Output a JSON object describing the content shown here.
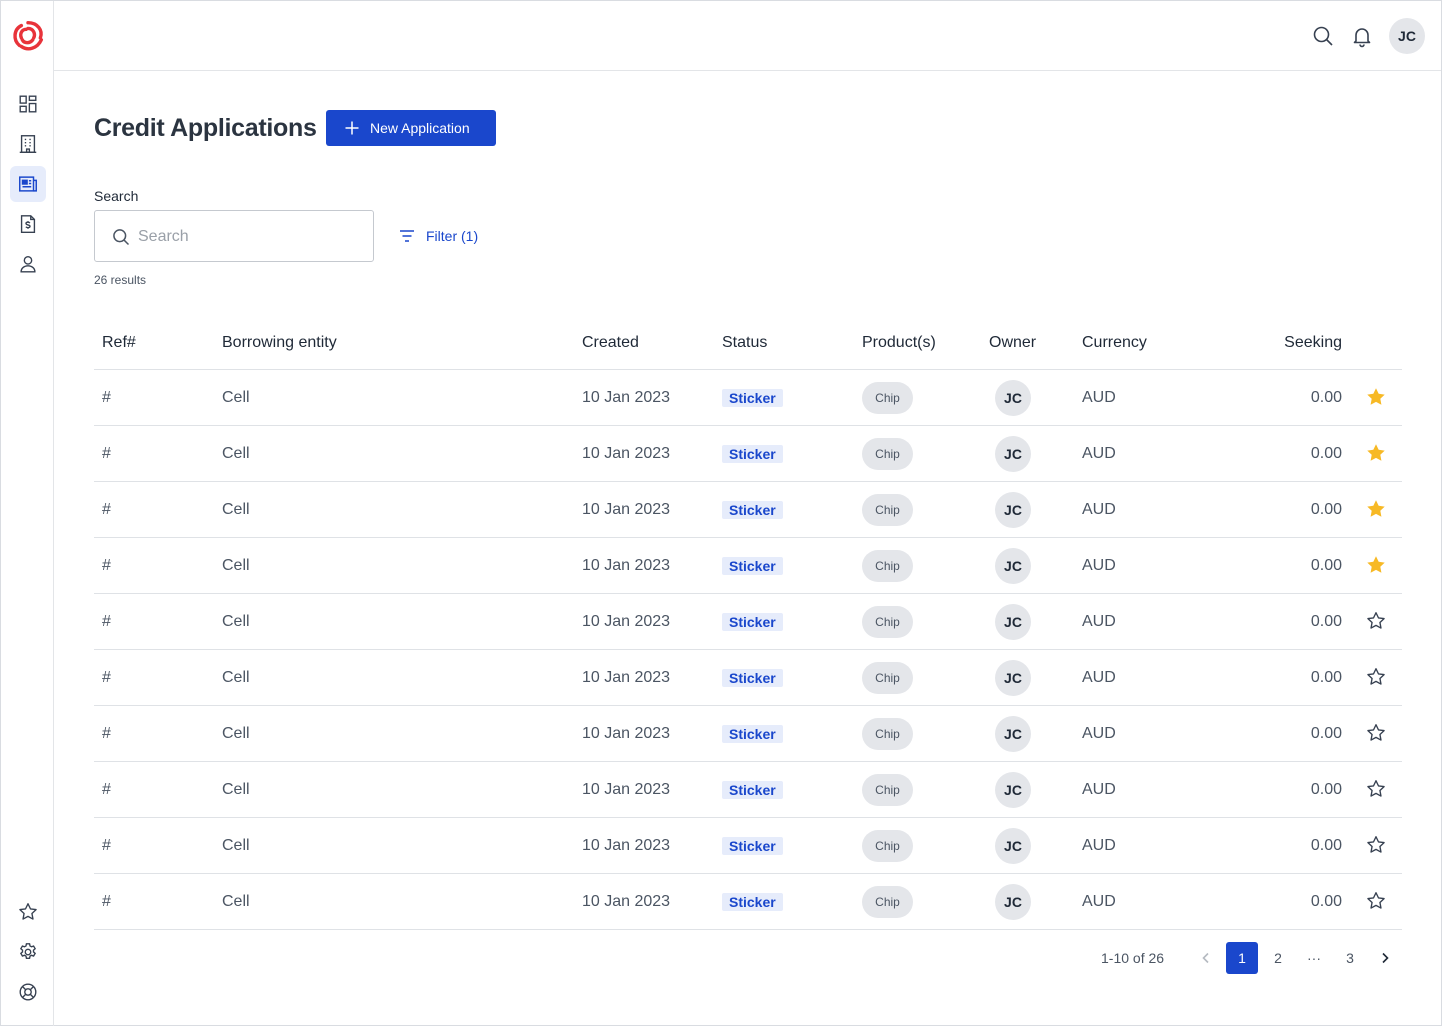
{
  "header": {
    "user_initials": "JC"
  },
  "page": {
    "title": "Credit Applications",
    "new_button_label": "New Application",
    "search_label": "Search",
    "search_placeholder": "Search",
    "search_value": "",
    "filter_label": "Filter (1)",
    "results_text": "26 results"
  },
  "table": {
    "columns": [
      "Ref#",
      "Borrowing entity",
      "Created",
      "Status",
      "Product(s)",
      "Owner",
      "Currency",
      "Seeking"
    ],
    "rows": [
      {
        "ref": "#",
        "entity": "Cell",
        "created": "10 Jan 2023",
        "status": "Sticker",
        "product": "Chip",
        "owner": "JC",
        "currency": "AUD",
        "seeking": "0.00",
        "starred": true
      },
      {
        "ref": "#",
        "entity": "Cell",
        "created": "10 Jan 2023",
        "status": "Sticker",
        "product": "Chip",
        "owner": "JC",
        "currency": "AUD",
        "seeking": "0.00",
        "starred": true
      },
      {
        "ref": "#",
        "entity": "Cell",
        "created": "10 Jan 2023",
        "status": "Sticker",
        "product": "Chip",
        "owner": "JC",
        "currency": "AUD",
        "seeking": "0.00",
        "starred": true
      },
      {
        "ref": "#",
        "entity": "Cell",
        "created": "10 Jan 2023",
        "status": "Sticker",
        "product": "Chip",
        "owner": "JC",
        "currency": "AUD",
        "seeking": "0.00",
        "starred": true
      },
      {
        "ref": "#",
        "entity": "Cell",
        "created": "10 Jan 2023",
        "status": "Sticker",
        "product": "Chip",
        "owner": "JC",
        "currency": "AUD",
        "seeking": "0.00",
        "starred": false
      },
      {
        "ref": "#",
        "entity": "Cell",
        "created": "10 Jan 2023",
        "status": "Sticker",
        "product": "Chip",
        "owner": "JC",
        "currency": "AUD",
        "seeking": "0.00",
        "starred": false
      },
      {
        "ref": "#",
        "entity": "Cell",
        "created": "10 Jan 2023",
        "status": "Sticker",
        "product": "Chip",
        "owner": "JC",
        "currency": "AUD",
        "seeking": "0.00",
        "starred": false
      },
      {
        "ref": "#",
        "entity": "Cell",
        "created": "10 Jan 2023",
        "status": "Sticker",
        "product": "Chip",
        "owner": "JC",
        "currency": "AUD",
        "seeking": "0.00",
        "starred": false
      },
      {
        "ref": "#",
        "entity": "Cell",
        "created": "10 Jan 2023",
        "status": "Sticker",
        "product": "Chip",
        "owner": "JC",
        "currency": "AUD",
        "seeking": "0.00",
        "starred": false
      },
      {
        "ref": "#",
        "entity": "Cell",
        "created": "10 Jan 2023",
        "status": "Sticker",
        "product": "Chip",
        "owner": "JC",
        "currency": "AUD",
        "seeking": "0.00",
        "starred": false
      }
    ]
  },
  "pagination": {
    "range_text": "1-10 of 26",
    "pages": [
      "1",
      "2",
      "···",
      "3"
    ],
    "current": "1"
  },
  "colors": {
    "accent": "#1a47cc",
    "star_filled": "#f7b925",
    "logo": "#e8333a"
  },
  "icons": {
    "sidebar_top": [
      "dashboard-icon",
      "building-icon",
      "applications-icon",
      "invoice-icon",
      "user-icon"
    ],
    "sidebar_bottom": [
      "star-icon",
      "gear-icon",
      "help-icon"
    ]
  }
}
